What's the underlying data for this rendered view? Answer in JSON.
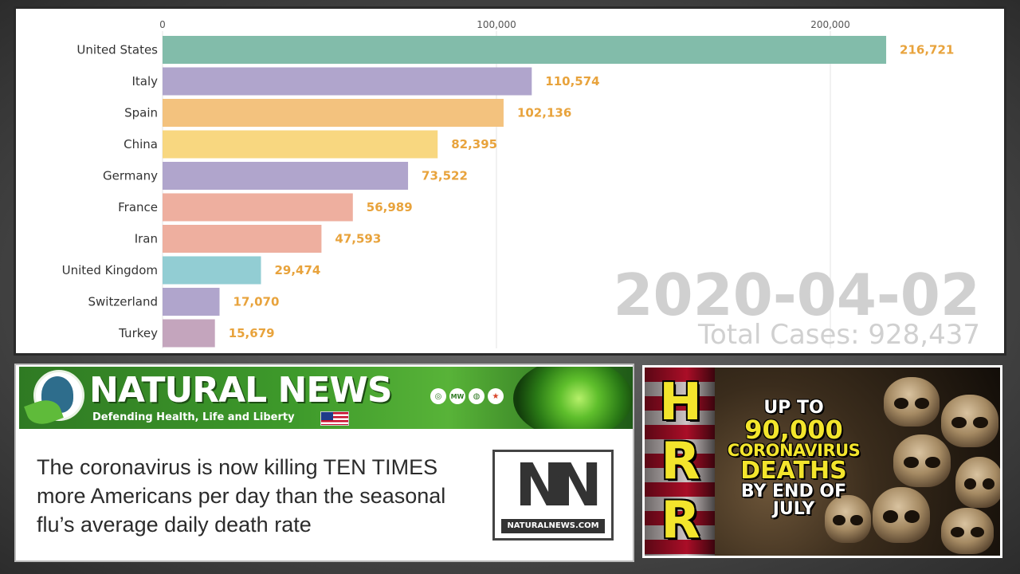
{
  "chart_data": {
    "type": "bar",
    "orientation": "horizontal",
    "categories": [
      "United States",
      "Italy",
      "Spain",
      "China",
      "Germany",
      "France",
      "Iran",
      "United Kingdom",
      "Switzerland",
      "Turkey"
    ],
    "values": [
      216721,
      110574,
      102136,
      82395,
      73522,
      56989,
      47593,
      29474,
      17070,
      15679
    ],
    "value_labels": [
      "216,721",
      "110,574",
      "102,136",
      "82,395",
      "73,522",
      "56,989",
      "47,593",
      "29,474",
      "17,070",
      "15,679"
    ],
    "colors": [
      "#82bcaa",
      "#b0a5cc",
      "#f3c27e",
      "#f8d780",
      "#b0a5cc",
      "#eeaf9f",
      "#eeaf9f",
      "#92cdd3",
      "#b0a5cc",
      "#c4a5bd"
    ],
    "xticks": [
      0,
      100000,
      200000
    ],
    "xtick_labels": [
      "0",
      "100,000",
      "200,000"
    ],
    "xlim": [
      0,
      230000
    ],
    "grid": true,
    "date": "2020-04-02",
    "total": "Total Cases: 928,437"
  },
  "news": {
    "brand": "NATURAL NEWS",
    "tagline": "Defending Health, Life and Liberty",
    "social_icons": [
      "◎",
      "MW",
      "◍",
      "★"
    ],
    "headline_lines": [
      "The coronavirus is now killing TEN TIMES",
      "more Americans per day than the seasonal",
      "flu’s average daily death rate"
    ],
    "logo_letters": "NN",
    "logo_url": "NATURALNEWS.COM"
  },
  "hrr": {
    "letters": [
      "H",
      "R",
      "R"
    ],
    "lines": [
      "UP TO",
      "90,000",
      "CORONAVIRUS",
      "DEATHS",
      "BY END OF",
      "JULY"
    ],
    "colors": [
      "#ffffff",
      "#f3e52c",
      "#f3e52c",
      "#f3e52c",
      "#ffffff",
      "#ffffff"
    ]
  }
}
